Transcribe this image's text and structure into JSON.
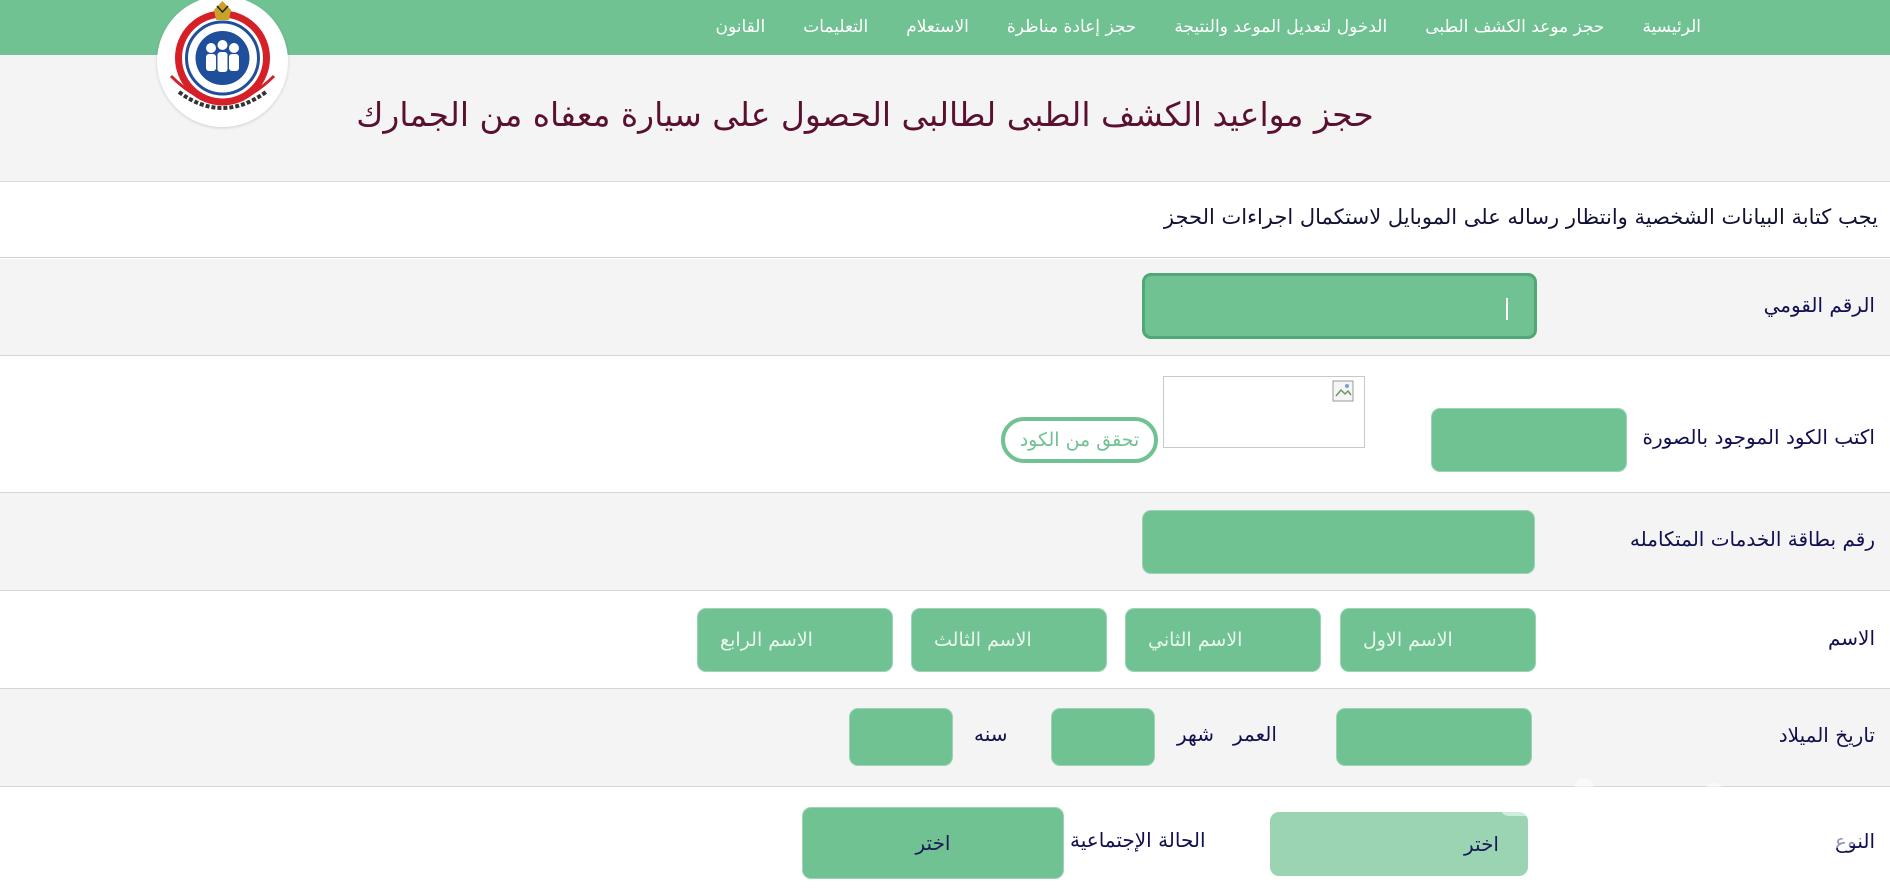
{
  "nav": {
    "items": [
      "الرئيسية",
      "حجز موعد الكشف الطبى",
      "الدخول لتعديل الموعد والنتيجة",
      "حجز إعادة مناظرة",
      "الاستعلام",
      "التعليمات",
      "القانون"
    ]
  },
  "header": {
    "title": "حجز مواعيد الكشف الطبى لطالبى الحصول على سيارة معفاه من الجمارك"
  },
  "notice": "يجب كتابة البيانات الشخصية وانتظار رساله على الموبايل لاستكمال اجراءات الحجز",
  "form": {
    "national_id_label": "الرقم القومي",
    "captcha_label": "اكتب الكود الموجود بالصورة",
    "verify_button": "تحقق من الكود",
    "services_card_label": "رقم بطاقة الخدمات المتكامله",
    "name_label": "الاسم",
    "name_placeholders": {
      "first": "الاسم الاول",
      "second": "الاسم الثاني",
      "third": "الاسم الثالث",
      "fourth": "الاسم الرابع"
    },
    "birth_label": "تاريخ الميلاد",
    "age_label": "العمر",
    "month_label": "شهر",
    "year_label": "سنه",
    "gender_label_partial": "النوع",
    "gender_select_value": "اختر",
    "marital_label": "الحالة الإجتماعية",
    "marital_select_value": "اختر"
  },
  "colors": {
    "nav_bg": "#70c293",
    "field_bg": "#70c293",
    "title": "#5a1030"
  },
  "icons": {
    "logo": "ministry-of-health-logo",
    "captcha": "broken-image-icon"
  }
}
